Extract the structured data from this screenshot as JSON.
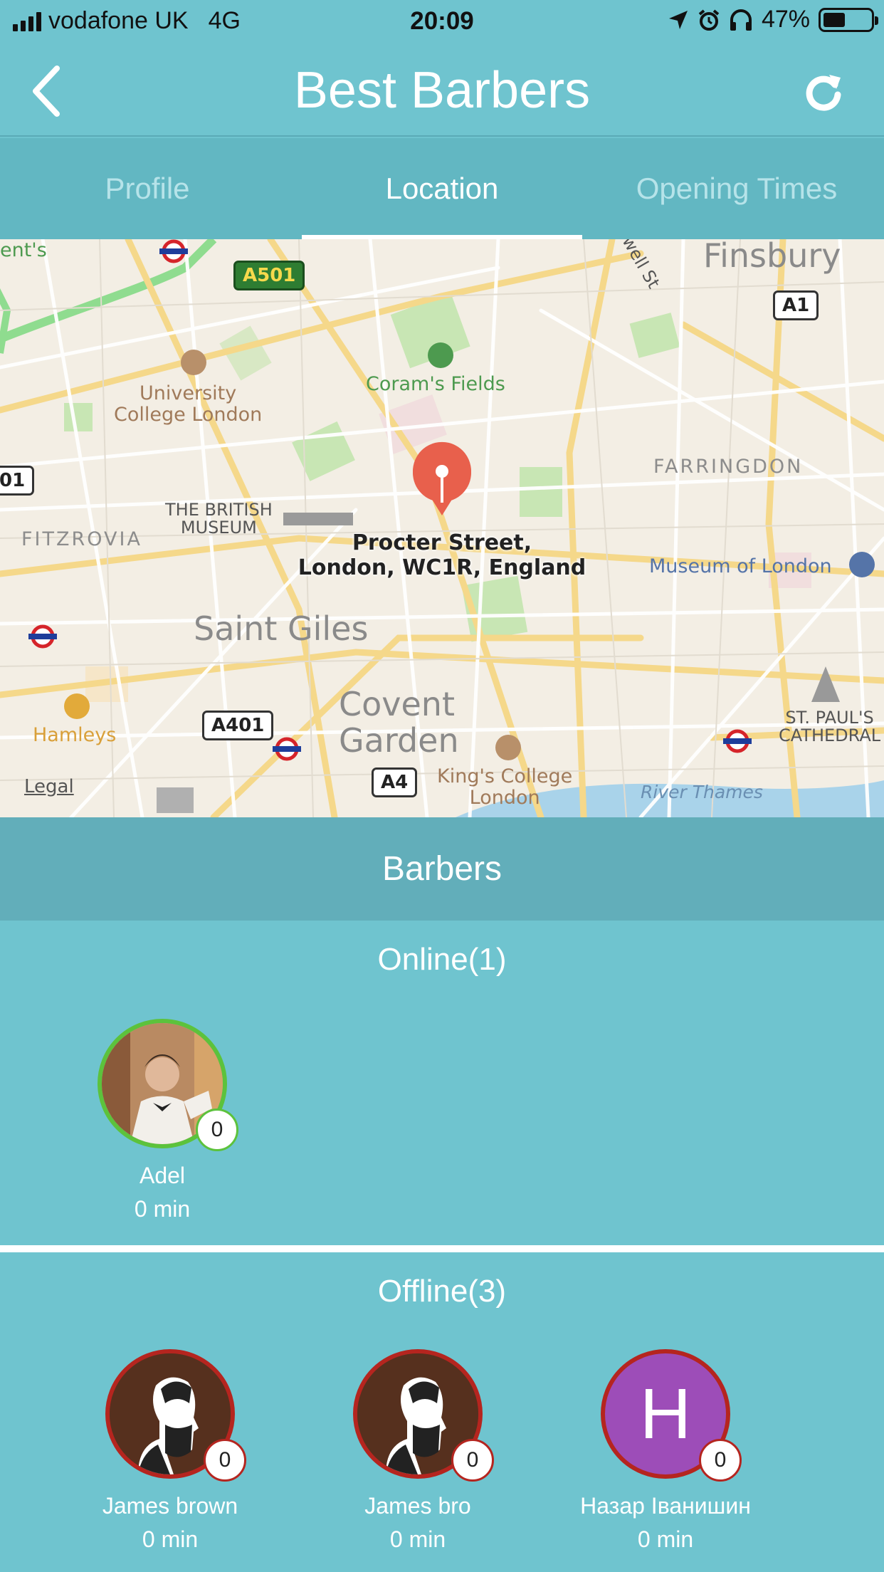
{
  "status_bar": {
    "carrier": "vodafone UK",
    "network": "4G",
    "time": "20:09",
    "battery_percent": "47%",
    "battery_level": 0.47,
    "icons": [
      "location-arrow-icon",
      "alarm-icon",
      "headphones-icon"
    ]
  },
  "nav": {
    "title": "Best Barbers",
    "back_icon": "chevron-left-icon",
    "refresh_icon": "refresh-icon"
  },
  "tabs": [
    {
      "label": "Profile",
      "active": false
    },
    {
      "label": "Location",
      "active": true
    },
    {
      "label": "Opening Times",
      "active": false
    }
  ],
  "map": {
    "pin_address_line1": "Procter Street,",
    "pin_address_line2": "London, WC1R, England",
    "legal": "Legal",
    "labels": {
      "finsbury": "Finsbury",
      "ucl_1": "University",
      "ucl_2": "College London",
      "corams_fields": "Coram's Fields",
      "farringdon": "FARRINGDON",
      "british_museum_1": "THE BRITISH",
      "british_museum_2": "MUSEUM",
      "fitzrovia": "FITZROVIA",
      "museum_of_london": "Museum of London",
      "saint_giles": "Saint Giles",
      "covent_1": "Covent",
      "covent_2": "Garden",
      "hamleys": "Hamleys",
      "kings_1": "King's College",
      "kings_2": "London",
      "st_pauls_1": "ST. PAUL'S",
      "st_pauls_2": "CATHEDRAL",
      "river_thames": "River Thames",
      "street_partial": "ent's",
      "well_st": "well St",
      "edge_road": "01"
    },
    "roads": {
      "a501": "A501",
      "a1": "A1",
      "a401": "A401",
      "a4": "A4"
    }
  },
  "barbers": {
    "header": "Barbers",
    "online_title": "Online(1)",
    "offline_title": "Offline(3)",
    "online": [
      {
        "name": "Adel",
        "wait": "0 min",
        "count": "0",
        "avatar": "photo"
      }
    ],
    "offline": [
      {
        "name": "James brown",
        "wait": "0 min",
        "count": "0",
        "avatar": "bearded-man-icon"
      },
      {
        "name": "James bro",
        "wait": "0 min",
        "count": "0",
        "avatar": "bearded-man-icon"
      },
      {
        "name": "Назар Іванишин",
        "wait": "0 min",
        "count": "0",
        "avatar": "H"
      }
    ]
  },
  "colors": {
    "primary": "#6fc4cf",
    "tab_bar": "#62b7c2",
    "section_header": "#62aeba",
    "online_ring": "#5cc23c",
    "offline_ring": "#b5251f",
    "pin": "#e8604c"
  }
}
